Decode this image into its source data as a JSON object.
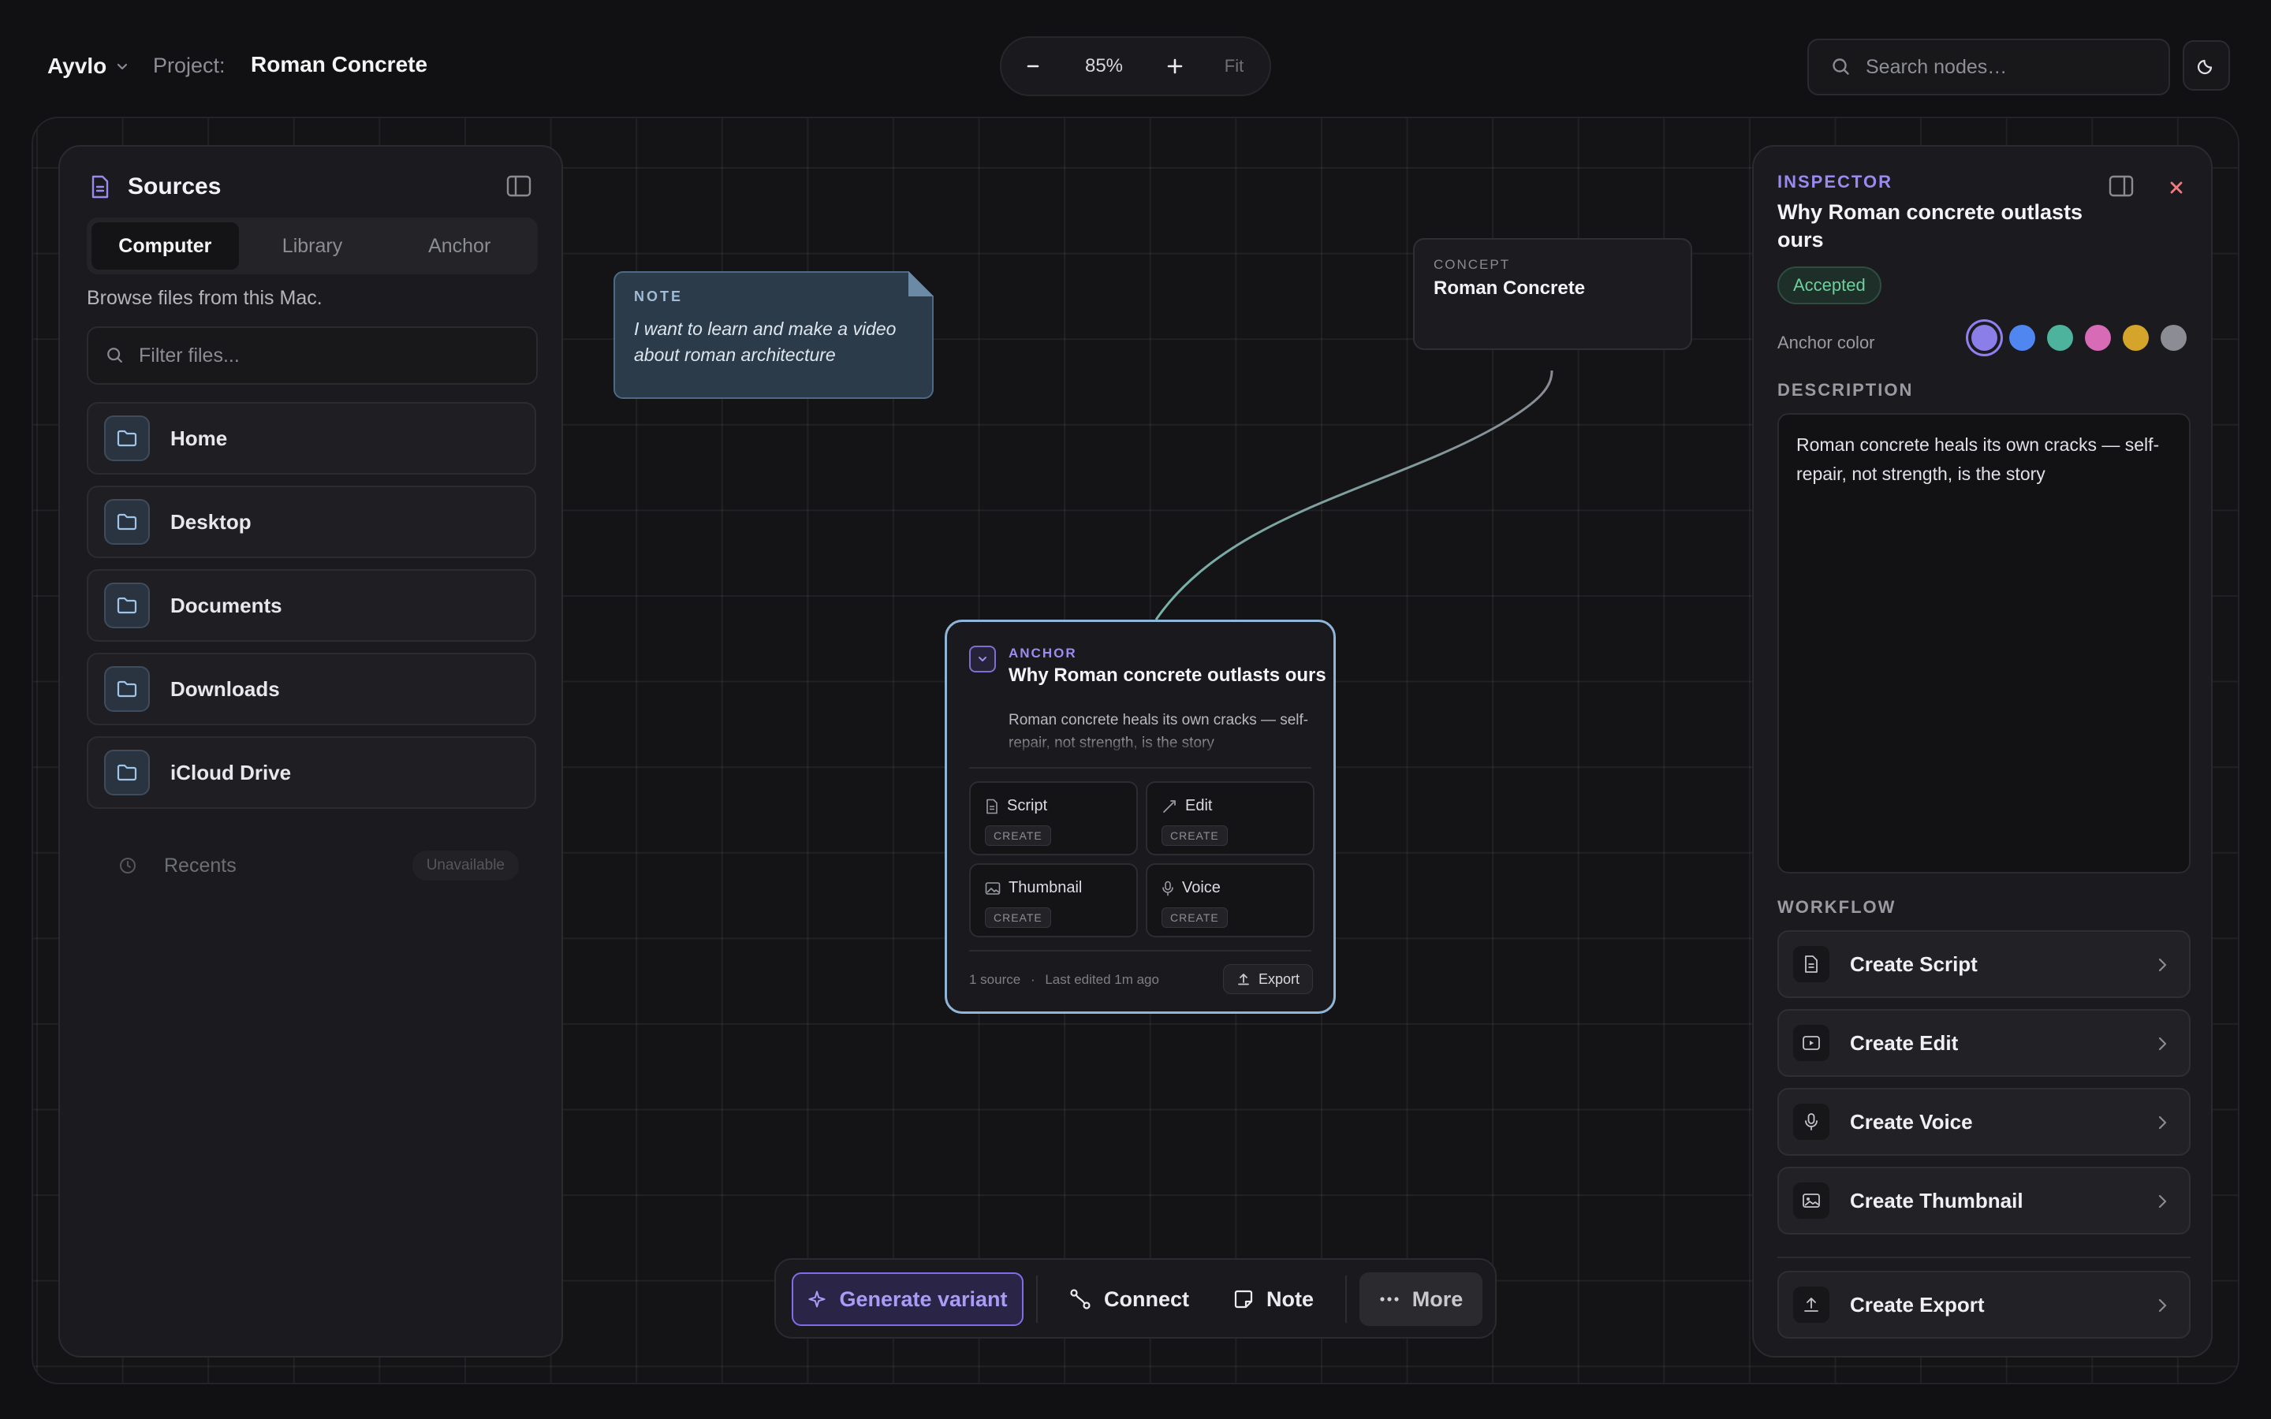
{
  "topbar": {
    "brand": "Ayvlo",
    "project_label": "Project:",
    "project_name": "Roman Concrete",
    "zoom": {
      "minus": "−",
      "value": "85%",
      "plus": "+",
      "fit": "Fit"
    },
    "search_placeholder": "Search nodes…"
  },
  "sources": {
    "title": "Sources",
    "tabs": [
      {
        "label": "Computer",
        "active": true
      },
      {
        "label": "Library",
        "active": false
      },
      {
        "label": "Anchor",
        "active": false
      }
    ],
    "browse_text": "Browse files from this Mac.",
    "filter_placeholder": "Filter files...",
    "folders": [
      {
        "label": "Home"
      },
      {
        "label": "Desktop"
      },
      {
        "label": "Documents"
      },
      {
        "label": "Downloads"
      },
      {
        "label": "iCloud Drive"
      }
    ],
    "recents": {
      "label": "Recents",
      "status": "Unavailable"
    }
  },
  "canvas": {
    "note": {
      "label": "NOTE",
      "text": "I want to learn and make a video about roman architecture"
    },
    "concept": {
      "label": "CONCEPT",
      "name": "Roman Concrete"
    },
    "anchor": {
      "label": "ANCHOR",
      "title": "Why Roman concrete outlasts ours",
      "description": "Roman concrete heals its own cracks — self-repair, not strength, is the story",
      "tiles": [
        {
          "label": "Script",
          "action": "CREATE",
          "icon": "file-icon"
        },
        {
          "label": "Edit",
          "action": "CREATE",
          "icon": "wand-icon"
        },
        {
          "label": "Thumbnail",
          "action": "CREATE",
          "icon": "image-icon"
        },
        {
          "label": "Voice",
          "action": "CREATE",
          "icon": "mic-icon"
        }
      ],
      "sources_count": "1 source",
      "separator": "·",
      "last_edited": "Last edited 1m ago",
      "export_label": "Export"
    }
  },
  "toolbar": {
    "generate": "Generate variant",
    "connect": "Connect",
    "note": "Note",
    "more": "More"
  },
  "inspector": {
    "label": "INSPECTOR",
    "title": "Why Roman concrete outlasts ours",
    "status": "Accepted",
    "anchor_color_label": "Anchor color",
    "colors": [
      "#8b7ee8",
      "#4f86f0",
      "#4db39c",
      "#d86bb6",
      "#d4a52a",
      "#8c8c94"
    ],
    "selected_color": "#8b7ee8",
    "description_label": "DESCRIPTION",
    "description": "Roman concrete heals its own cracks — self-repair, not strength, is the story",
    "workflow_label": "WORKFLOW",
    "workflow": [
      {
        "label": "Create Script",
        "icon": "file-icon"
      },
      {
        "label": "Create Edit",
        "icon": "video-icon"
      },
      {
        "label": "Create Voice",
        "icon": "mic-icon"
      },
      {
        "label": "Create Thumbnail",
        "icon": "image-icon"
      },
      {
        "label": "Create Export",
        "icon": "upload-icon"
      }
    ]
  },
  "colors": {
    "accent_purple": "#8f7ff2",
    "accepted_green": "#6fcf9e",
    "anchor_border": "#8fb6d8",
    "edge_teal": "#76b3a8",
    "close_red": "#f07a80"
  }
}
